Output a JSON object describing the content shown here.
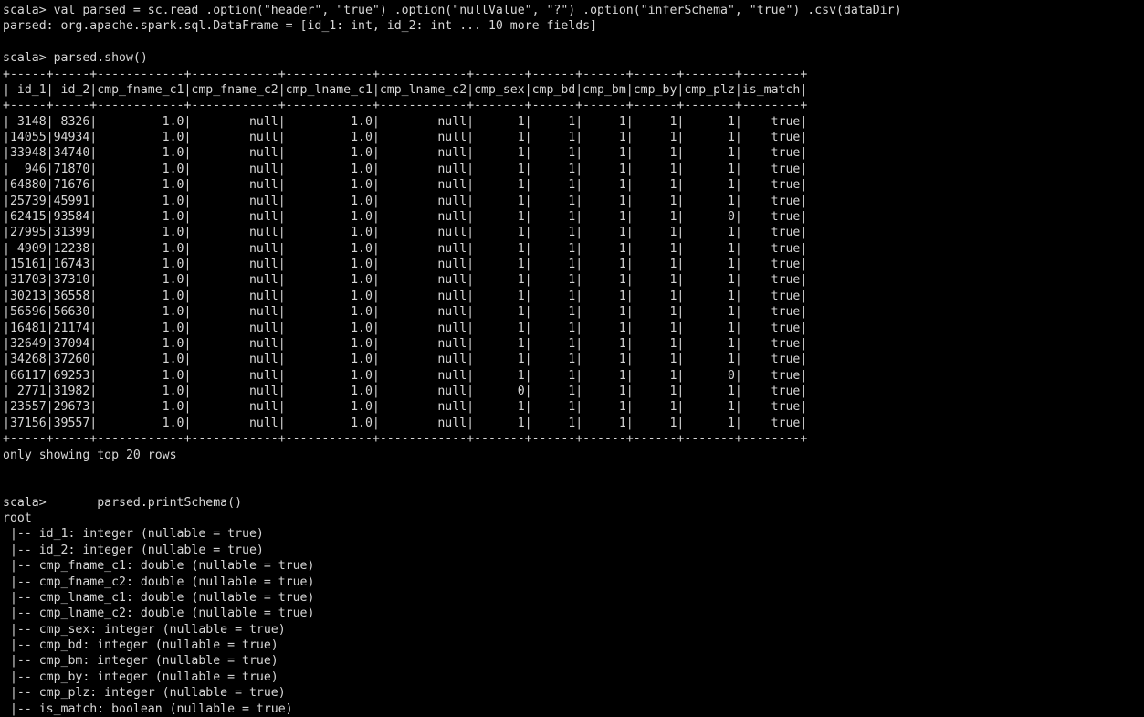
{
  "terminal": {
    "prompt": "scala> ",
    "foreground_color": "#d6d6d6",
    "background_color": "#000000",
    "commands": {
      "read_csv": "val parsed = sc.read .option(\"header\", \"true\") .option(\"nullValue\", \"?\") .option(\"inferSchema\", \"true\") .csv(dataDir)",
      "show": "parsed.show()",
      "print_schema": "      parsed.printSchema()"
    },
    "results": {
      "dataframe_type": "parsed: org.apache.spark.sql.DataFrame = [id_1: int, id_2: int ... 10 more fields]",
      "footer_note": "only showing top 20 rows",
      "schema_root": "root"
    }
  },
  "table": {
    "columns": [
      {
        "name": "id_1",
        "width": 5,
        "align": "right"
      },
      {
        "name": "id_2",
        "width": 5,
        "align": "right"
      },
      {
        "name": "cmp_fname_c1",
        "width": 12,
        "align": "right"
      },
      {
        "name": "cmp_fname_c2",
        "width": 12,
        "align": "right"
      },
      {
        "name": "cmp_lname_c1",
        "width": 12,
        "align": "right"
      },
      {
        "name": "cmp_lname_c2",
        "width": 12,
        "align": "right"
      },
      {
        "name": "cmp_sex",
        "width": 7,
        "align": "right"
      },
      {
        "name": "cmp_bd",
        "width": 6,
        "align": "right"
      },
      {
        "name": "cmp_bm",
        "width": 6,
        "align": "right"
      },
      {
        "name": "cmp_by",
        "width": 6,
        "align": "right"
      },
      {
        "name": "cmp_plz",
        "width": 7,
        "align": "right"
      },
      {
        "name": "is_match",
        "width": 8,
        "align": "right"
      }
    ],
    "rows": [
      [
        "3148",
        "8326",
        "1.0",
        "null",
        "1.0",
        "null",
        "1",
        "1",
        "1",
        "1",
        "1",
        "true"
      ],
      [
        "14055",
        "94934",
        "1.0",
        "null",
        "1.0",
        "null",
        "1",
        "1",
        "1",
        "1",
        "1",
        "true"
      ],
      [
        "33948",
        "34740",
        "1.0",
        "null",
        "1.0",
        "null",
        "1",
        "1",
        "1",
        "1",
        "1",
        "true"
      ],
      [
        "946",
        "71870",
        "1.0",
        "null",
        "1.0",
        "null",
        "1",
        "1",
        "1",
        "1",
        "1",
        "true"
      ],
      [
        "64880",
        "71676",
        "1.0",
        "null",
        "1.0",
        "null",
        "1",
        "1",
        "1",
        "1",
        "1",
        "true"
      ],
      [
        "25739",
        "45991",
        "1.0",
        "null",
        "1.0",
        "null",
        "1",
        "1",
        "1",
        "1",
        "1",
        "true"
      ],
      [
        "62415",
        "93584",
        "1.0",
        "null",
        "1.0",
        "null",
        "1",
        "1",
        "1",
        "1",
        "0",
        "true"
      ],
      [
        "27995",
        "31399",
        "1.0",
        "null",
        "1.0",
        "null",
        "1",
        "1",
        "1",
        "1",
        "1",
        "true"
      ],
      [
        "4909",
        "12238",
        "1.0",
        "null",
        "1.0",
        "null",
        "1",
        "1",
        "1",
        "1",
        "1",
        "true"
      ],
      [
        "15161",
        "16743",
        "1.0",
        "null",
        "1.0",
        "null",
        "1",
        "1",
        "1",
        "1",
        "1",
        "true"
      ],
      [
        "31703",
        "37310",
        "1.0",
        "null",
        "1.0",
        "null",
        "1",
        "1",
        "1",
        "1",
        "1",
        "true"
      ],
      [
        "30213",
        "36558",
        "1.0",
        "null",
        "1.0",
        "null",
        "1",
        "1",
        "1",
        "1",
        "1",
        "true"
      ],
      [
        "56596",
        "56630",
        "1.0",
        "null",
        "1.0",
        "null",
        "1",
        "1",
        "1",
        "1",
        "1",
        "true"
      ],
      [
        "16481",
        "21174",
        "1.0",
        "null",
        "1.0",
        "null",
        "1",
        "1",
        "1",
        "1",
        "1",
        "true"
      ],
      [
        "32649",
        "37094",
        "1.0",
        "null",
        "1.0",
        "null",
        "1",
        "1",
        "1",
        "1",
        "1",
        "true"
      ],
      [
        "34268",
        "37260",
        "1.0",
        "null",
        "1.0",
        "null",
        "1",
        "1",
        "1",
        "1",
        "1",
        "true"
      ],
      [
        "66117",
        "69253",
        "1.0",
        "null",
        "1.0",
        "null",
        "1",
        "1",
        "1",
        "1",
        "0",
        "true"
      ],
      [
        "2771",
        "31982",
        "1.0",
        "null",
        "1.0",
        "null",
        "0",
        "1",
        "1",
        "1",
        "1",
        "true"
      ],
      [
        "23557",
        "29673",
        "1.0",
        "null",
        "1.0",
        "null",
        "1",
        "1",
        "1",
        "1",
        "1",
        "true"
      ],
      [
        "37156",
        "39557",
        "1.0",
        "null",
        "1.0",
        "null",
        "1",
        "1",
        "1",
        "1",
        "1",
        "true"
      ]
    ]
  },
  "schema": {
    "root_label": "root",
    "fields": [
      {
        "name": "id_1",
        "type": "integer",
        "nullable": "true"
      },
      {
        "name": "id_2",
        "type": "integer",
        "nullable": "true"
      },
      {
        "name": "cmp_fname_c1",
        "type": "double",
        "nullable": "true"
      },
      {
        "name": "cmp_fname_c2",
        "type": "double",
        "nullable": "true"
      },
      {
        "name": "cmp_lname_c1",
        "type": "double",
        "nullable": "true"
      },
      {
        "name": "cmp_lname_c2",
        "type": "double",
        "nullable": "true"
      },
      {
        "name": "cmp_sex",
        "type": "integer",
        "nullable": "true"
      },
      {
        "name": "cmp_bd",
        "type": "integer",
        "nullable": "true"
      },
      {
        "name": "cmp_bm",
        "type": "integer",
        "nullable": "true"
      },
      {
        "name": "cmp_by",
        "type": "integer",
        "nullable": "true"
      },
      {
        "name": "cmp_plz",
        "type": "integer",
        "nullable": "true"
      },
      {
        "name": "is_match",
        "type": "boolean",
        "nullable": "true"
      }
    ]
  }
}
